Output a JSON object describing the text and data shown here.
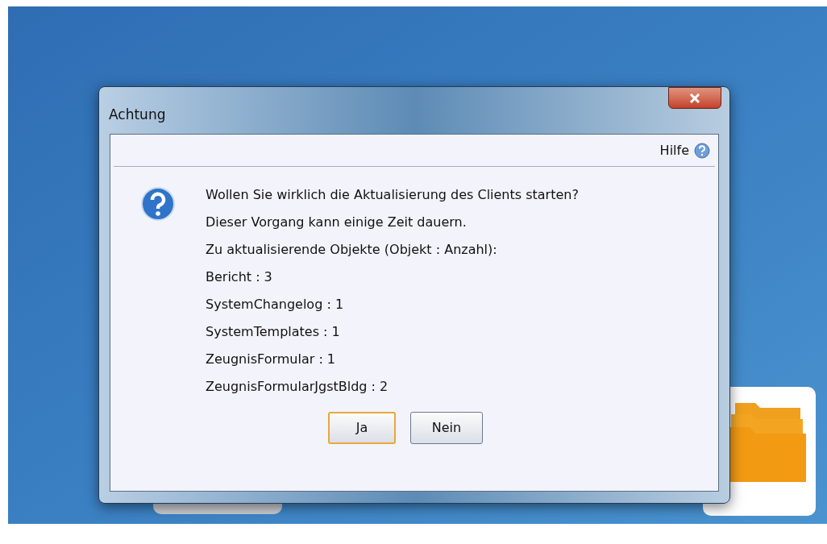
{
  "window": {
    "title": "Achtung"
  },
  "help": {
    "label": "Hilfe"
  },
  "message_lines": [
    "Wollen Sie wirklich die Aktualisierung des Clients starten?",
    "Dieser Vorgang kann einige Zeit dauern.",
    "Zu aktualisierende Objekte (Objekt : Anzahl):",
    "Bericht : 3",
    "SystemChangelog : 1",
    "SystemTemplates : 1",
    "ZeugnisFormular : 1",
    "ZeugnisFormularJgstBldg : 2"
  ],
  "buttons": [
    {
      "label": "Ja",
      "default": true
    },
    {
      "label": "Nein",
      "default": false
    }
  ]
}
